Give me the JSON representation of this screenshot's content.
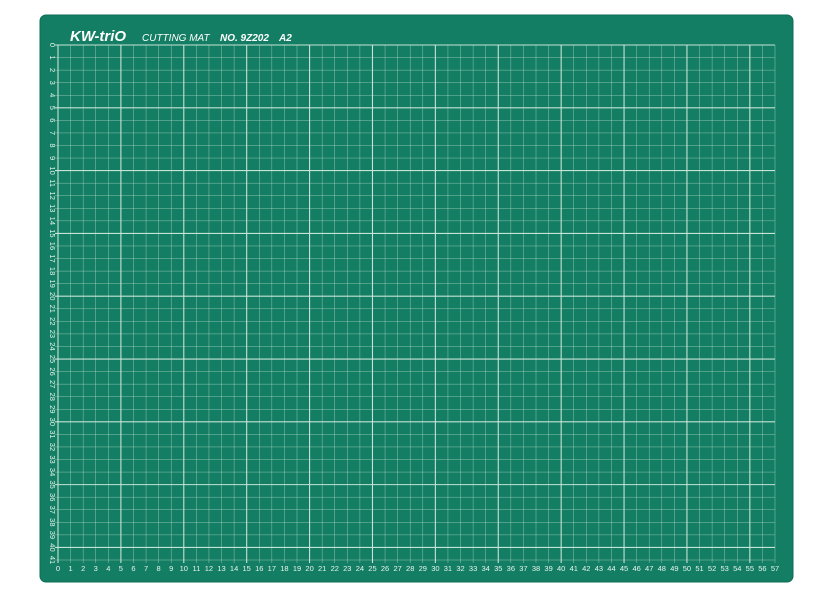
{
  "brand": {
    "logo_text": "KW-triO",
    "product_name": "CUTTING MAT",
    "model_number": "NO. 9Z202",
    "size": "A2"
  },
  "rulers": {
    "bottom_ticks": [
      "0",
      "1",
      "2",
      "3",
      "4",
      "5",
      "6",
      "7",
      "8",
      "9",
      "10",
      "11",
      "12",
      "13",
      "14",
      "15",
      "16",
      "17",
      "18",
      "19",
      "20",
      "21",
      "22",
      "23",
      "24",
      "25",
      "26",
      "27",
      "28",
      "29",
      "30",
      "31",
      "32",
      "33",
      "34",
      "35",
      "36",
      "37",
      "38",
      "39",
      "40",
      "41",
      "42",
      "43",
      "44",
      "45",
      "46",
      "47",
      "48",
      "49",
      "50",
      "51",
      "52",
      "53",
      "54",
      "55",
      "56",
      "57"
    ],
    "left_ticks": [
      "0",
      "1",
      "2",
      "3",
      "4",
      "5",
      "6",
      "7",
      "8",
      "9",
      "10",
      "11",
      "12",
      "13",
      "14",
      "15",
      "16",
      "17",
      "18",
      "19",
      "20",
      "21",
      "22",
      "23",
      "24",
      "25",
      "26",
      "27",
      "28",
      "29",
      "30",
      "31",
      "32",
      "33",
      "34",
      "35",
      "36",
      "37",
      "38",
      "39",
      "40",
      "41"
    ]
  },
  "colors": {
    "mat": "#137e63",
    "mat_edge": "#0e6c54",
    "grid_line": "#cfe9dd",
    "label": "#ffffff"
  }
}
